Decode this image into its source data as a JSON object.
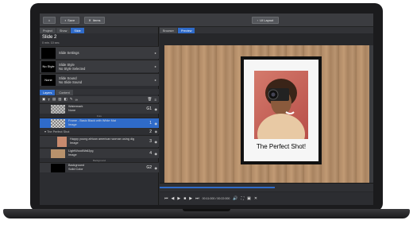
{
  "toolbar": {
    "home_label": "",
    "save_label": "Save",
    "items_label": "Items",
    "ui_layout_label": "UI Layout"
  },
  "left_tabs": [
    "Project",
    "Show",
    "Slide"
  ],
  "right_tabs": [
    "Browser",
    "Preview"
  ],
  "slide": {
    "title": "Slide 2",
    "subtitle": "0 min. 10 sec."
  },
  "properties": [
    {
      "swatch": "",
      "line1": "Slide Settings",
      "line2": ""
    },
    {
      "swatch": "No Style",
      "line1": "Slide Style",
      "line2": "No Style Selected"
    },
    {
      "swatch": "None",
      "line1": "Slide Sound",
      "line2": "No Slide Sound"
    }
  ],
  "layer_tabs": [
    "Layers",
    "Content"
  ],
  "layers": [
    {
      "line1": "Watermark",
      "line2": "None",
      "num": "G1"
    },
    {
      "line1": "Frame - Basic Black with White Mat",
      "line2": "Image",
      "num": "1"
    },
    {
      "line1": "Happy young african american woman using dig",
      "line2": "Image",
      "num": "3"
    },
    {
      "line1": "LightWoodWallJpg",
      "line2": "Image",
      "num": "4"
    },
    {
      "line1": "Background",
      "line2": "Solid Color",
      "num": "G2"
    }
  ],
  "group_header": "The Perfect Shot",
  "group_num": "2",
  "tiny_labels": {
    "top": "Fore",
    "mid": "Background"
  },
  "preview": {
    "caption": "The Perfect Shot!"
  },
  "player": {
    "time": "00:11:000 / 00:22:000"
  }
}
